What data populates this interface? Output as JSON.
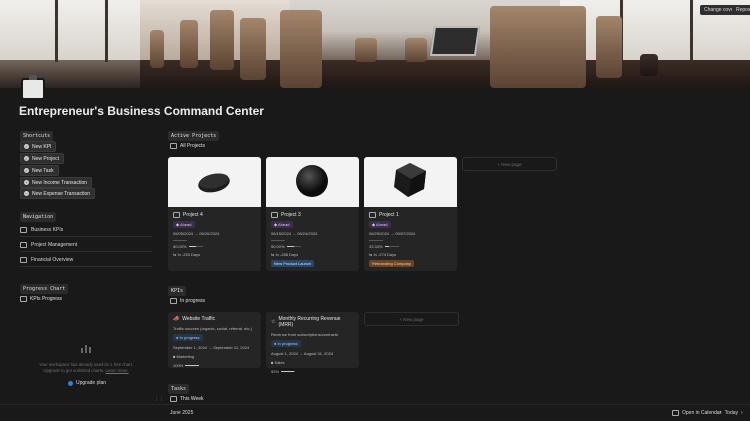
{
  "cover": {
    "change_cover": "Change cover",
    "reposition": "Reposition"
  },
  "page": {
    "title": "Entrepreneur's Business Command Center"
  },
  "shortcuts": {
    "label": "Shortcuts",
    "buttons": [
      "New KPI",
      "New Project",
      "New Task",
      "New Income Transaction",
      "New Expense Transaction"
    ]
  },
  "navigation": {
    "label": "Navigation",
    "items": [
      "Business KPIs",
      "Project Management",
      "Financial Overview"
    ]
  },
  "progress_chart": {
    "label": "Progress Chart",
    "view": "KPIs Progress",
    "upgrade_text_1": "Your workspace has already used its 1 free chart.",
    "upgrade_text_2": "Upgrade to get unlimited charts.",
    "learn_more": "Learn more.",
    "upgrade_button": "Upgrade plan"
  },
  "active_projects": {
    "label": "Active Projects",
    "view": "All Projects",
    "new_page": "+ New page",
    "cards": [
      {
        "name": "Project 4",
        "status": "Ahead",
        "dates": "06/05/2024 → 06/20/2024",
        "percent": "50.00%",
        "progress": 0.5,
        "days": "⇆ In -253 Days",
        "tag": "",
        "tag_style": ""
      },
      {
        "name": "Project 3",
        "status": "Ahead",
        "dates": "06/15/2024 → 06/24/2024",
        "percent": "50.00%",
        "progress": 0.5,
        "days": "⇆ In -288 Days",
        "tag": "New Product Launch",
        "tag_style": "tag-blue"
      },
      {
        "name": "Project 1",
        "status": "Ahead",
        "dates": "06/25/2024 → 09/07/2024",
        "percent": "33.33%",
        "progress": 0.3333,
        "days": "⇆ In -274 Days",
        "tag": "Rebranding Company",
        "tag_style": "tag-orange"
      }
    ]
  },
  "kpis": {
    "label": "KPIs",
    "view": "In progress",
    "new_page": "+ New page",
    "cards": [
      {
        "name": "Website Traffic",
        "desc": "Traffic sources (organic, social, referral, etc.)",
        "status": "In progress",
        "dates": "September 1, 2024 → September 11, 2024",
        "tag": "Marketing",
        "percent": "100%",
        "progress": 1.0
      },
      {
        "name": "Monthly Recurring Revenue (MRR)",
        "desc": "Revenue from subscriptions/contracts",
        "status": "In progress",
        "dates": "August 1, 2024 → August 31, 2024",
        "tag": "Sales",
        "percent": "92%",
        "progress": 0.92
      }
    ]
  },
  "tasks": {
    "label": "Tasks",
    "view": "This Week",
    "month": "June 2025",
    "open_calendar": "Open in Calendar",
    "today": "Today"
  }
}
